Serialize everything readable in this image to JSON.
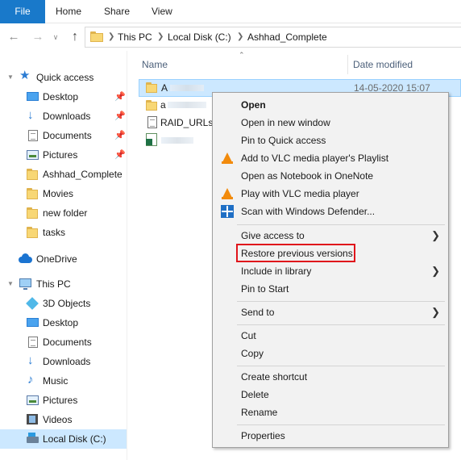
{
  "ribbon": {
    "tabs": [
      "File",
      "Home",
      "Share",
      "View"
    ]
  },
  "address": {
    "crumbs": [
      "This PC",
      "Local Disk (C:)",
      "Ashhad_Complete"
    ],
    "back_icon": "arrow-left-icon",
    "forward_icon": "arrow-right-icon",
    "up_icon": "arrow-up-icon"
  },
  "sidebar": {
    "quick_access": "Quick access",
    "quick_items": [
      "Desktop",
      "Downloads",
      "Documents",
      "Pictures",
      "Ashhad_Complete",
      "Movies",
      "new folder",
      "tasks"
    ],
    "onedrive": "OneDrive",
    "this_pc": "This PC",
    "pc_items": [
      "3D Objects",
      "Desktop",
      "Documents",
      "Downloads",
      "Music",
      "Pictures",
      "Videos",
      "Local Disk (C:)"
    ]
  },
  "files": {
    "header_name": "Name",
    "header_date": "Date modified",
    "rows": [
      {
        "name": "A",
        "date": "14-05-2020 15:07"
      },
      {
        "name": "a",
        "date": ""
      },
      {
        "name": "RAID_URLs",
        "date": ""
      },
      {
        "name": "",
        "date": ""
      }
    ]
  },
  "context_menu": {
    "items": [
      "Open",
      "Open in new window",
      "Pin to Quick access",
      "Add to VLC media player's Playlist",
      "Open as Notebook in OneNote",
      "Play with VLC media player",
      "Scan with Windows Defender...",
      "Give access to",
      "Restore previous versions",
      "Include in library",
      "Pin to Start",
      "Send to",
      "Cut",
      "Copy",
      "Create shortcut",
      "Delete",
      "Rename",
      "Properties"
    ],
    "highlight_color": "#e0141b"
  },
  "colors": {
    "accent": "#1979ca",
    "selection": "#cce8ff",
    "menu_bg": "#f2f2f2"
  }
}
